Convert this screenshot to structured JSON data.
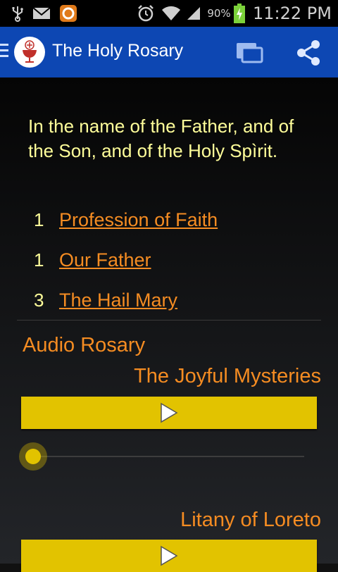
{
  "status_bar": {
    "battery_percent": "90%",
    "time": "11:22 PM",
    "icons": [
      "usb-icon",
      "mail-icon",
      "app-notification-icon",
      "alarm-icon",
      "wifi-icon",
      "signal-icon",
      "battery-charging-icon"
    ]
  },
  "app_bar": {
    "title": "The Holy Rosary",
    "icons": [
      "menu-icon",
      "chalice-logo-icon",
      "cast-icon",
      "share-icon"
    ],
    "color": "#0d47b3"
  },
  "content": {
    "intro": "In the name of the Father, and of the Son, and of the Holy Spìrit.",
    "prayers": [
      {
        "count": "1",
        "label": "Profession of Faith"
      },
      {
        "count": "1",
        "label": "Our Father"
      },
      {
        "count": "3",
        "label": "The Hail Mary"
      }
    ],
    "audio_heading": "Audio Rosary",
    "tracks": [
      {
        "title": "The Joyful Mysteries"
      },
      {
        "title": "Litany of Loreto"
      }
    ],
    "seek_progress": 0,
    "colors": {
      "text": "#fffe9a",
      "link": "#f58c22",
      "button": "#e2c300"
    }
  }
}
